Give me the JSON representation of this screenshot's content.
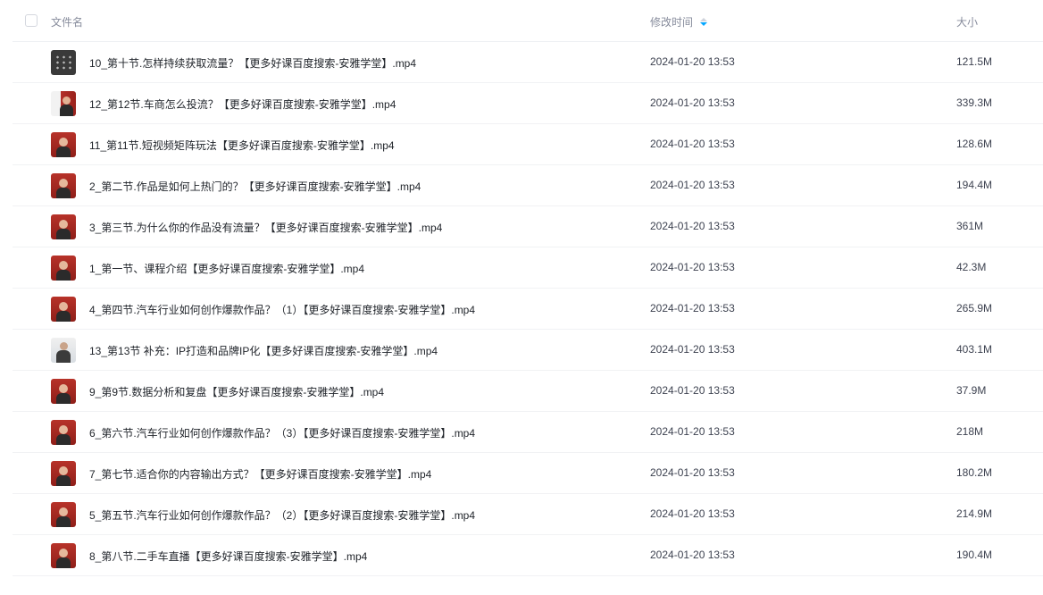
{
  "header": {
    "name_label": "文件名",
    "time_label": "修改时间",
    "size_label": "大小"
  },
  "files": [
    {
      "name": "10_第十节.怎样持续获取流量？【更多好课百度搜索-安雅学堂】.mp4",
      "time": "2024-01-20 13:53",
      "size": "121.5M",
      "thumb": "dark"
    },
    {
      "name": "12_第12节.车商怎么投流？【更多好课百度搜索-安雅学堂】.mp4",
      "time": "2024-01-20 13:53",
      "size": "339.3M",
      "thumb": "mixed"
    },
    {
      "name": "11_第11节.短视频矩阵玩法【更多好课百度搜索-安雅学堂】.mp4",
      "time": "2024-01-20 13:53",
      "size": "128.6M",
      "thumb": "red"
    },
    {
      "name": "2_第二节.作品是如何上热门的？【更多好课百度搜索-安雅学堂】.mp4",
      "time": "2024-01-20 13:53",
      "size": "194.4M",
      "thumb": "red"
    },
    {
      "name": "3_第三节.为什么你的作品没有流量？【更多好课百度搜索-安雅学堂】.mp4",
      "time": "2024-01-20 13:53",
      "size": "361M",
      "thumb": "red"
    },
    {
      "name": "1_第一节、课程介绍【更多好课百度搜索-安雅学堂】.mp4",
      "time": "2024-01-20 13:53",
      "size": "42.3M",
      "thumb": "red"
    },
    {
      "name": "4_第四节.汽车行业如何创作爆款作品？（1）【更多好课百度搜索-安雅学堂】.mp4",
      "time": "2024-01-20 13:53",
      "size": "265.9M",
      "thumb": "red"
    },
    {
      "name": "13_第13节 补充：IP打造和品牌IP化【更多好课百度搜索-安雅学堂】.mp4",
      "time": "2024-01-20 13:53",
      "size": "403.1M",
      "thumb": "light"
    },
    {
      "name": "9_第9节.数据分析和复盘【更多好课百度搜索-安雅学堂】.mp4",
      "time": "2024-01-20 13:53",
      "size": "37.9M",
      "thumb": "red"
    },
    {
      "name": "6_第六节.汽车行业如何创作爆款作品？（3）【更多好课百度搜索-安雅学堂】.mp4",
      "time": "2024-01-20 13:53",
      "size": "218M",
      "thumb": "red"
    },
    {
      "name": "7_第七节.适合你的内容输出方式？【更多好课百度搜索-安雅学堂】.mp4",
      "time": "2024-01-20 13:53",
      "size": "180.2M",
      "thumb": "red"
    },
    {
      "name": "5_第五节.汽车行业如何创作爆款作品？（2）【更多好课百度搜索-安雅学堂】.mp4",
      "time": "2024-01-20 13:53",
      "size": "214.9M",
      "thumb": "red"
    },
    {
      "name": "8_第八节.二手车直播【更多好课百度搜索-安雅学堂】.mp4",
      "time": "2024-01-20 13:53",
      "size": "190.4M",
      "thumb": "red"
    }
  ],
  "colors": {
    "sort_active": "#06a7ff",
    "header_text": "#878c9c",
    "row_divider": "#f1f2f4"
  }
}
